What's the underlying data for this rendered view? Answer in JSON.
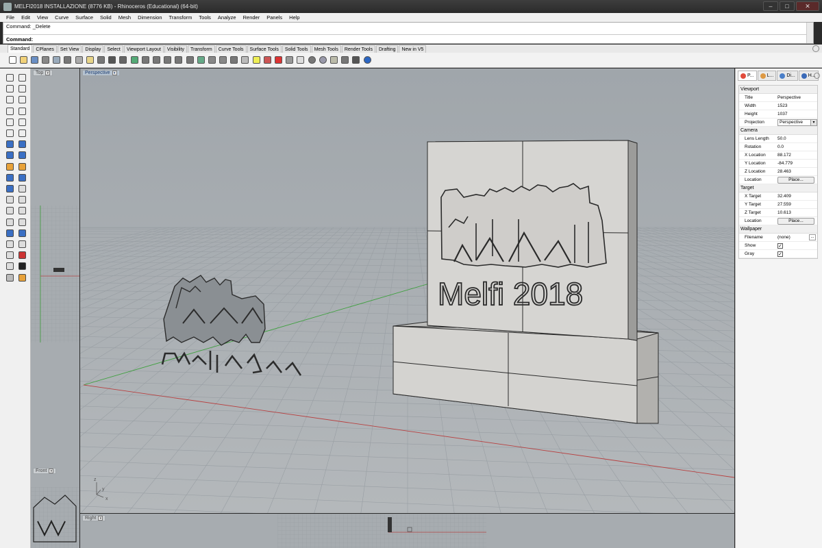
{
  "window": {
    "title": "MELFI2018 INSTALLAZIONE (8776 KB) - Rhinoceros (Educational) (64-bit)",
    "minimize": "–",
    "maximize": "□",
    "close": "✕"
  },
  "menu": [
    "File",
    "Edit",
    "View",
    "Curve",
    "Surface",
    "Solid",
    "Mesh",
    "Dimension",
    "Transform",
    "Tools",
    "Analyze",
    "Render",
    "Panels",
    "Help"
  ],
  "command": {
    "history": "Command: _Delete",
    "prompt": "Command:",
    "value": ""
  },
  "tabs": [
    "Standard",
    "CPlanes",
    "Set View",
    "Display",
    "Select",
    "Viewport Layout",
    "Visibility",
    "Transform",
    "Curve Tools",
    "Surface Tools",
    "Solid Tools",
    "Mesh Tools",
    "Render Tools",
    "Drafting",
    "New in V5"
  ],
  "active_tab": "Standard",
  "toolbar_icons": [
    "new-icon",
    "open-icon",
    "save-icon",
    "print-icon",
    "import-icon",
    "cut-icon",
    "copy-icon",
    "paste-icon",
    "undo-icon",
    "pan-icon",
    "move-icon",
    "rotate-view-icon",
    "zoom-icon",
    "zoom-window-icon",
    "zoom-extents-icon",
    "zoom-selected-icon",
    "rotate-icon",
    "four-view-icon",
    "grid-icon",
    "select-icon",
    "hide-icon",
    "lock-icon",
    "light-icon",
    "layer-icon",
    "properties-icon",
    "render-icon",
    "material-icon",
    "sphere-icon",
    "environment-icon",
    "options-icon",
    "walk-icon",
    "snap-icon",
    "help-icon"
  ],
  "viewports": {
    "top": "Top",
    "perspective": "Perspective",
    "front": "Front",
    "right": "Right"
  },
  "model": {
    "label": "Melfi 2018"
  },
  "panel": {
    "tabs": [
      "P...",
      "L...",
      "Di...",
      "H..."
    ],
    "sections": {
      "viewport": "Viewport",
      "camera": "Camera",
      "target": "Target",
      "wallpaper": "Wallpaper"
    },
    "viewport": {
      "title_label": "Title",
      "title": "Perspective",
      "width_label": "Width",
      "width": "1523",
      "height_label": "Height",
      "height": "1037",
      "projection_label": "Projection",
      "projection": "Perspective"
    },
    "camera": {
      "lens_label": "Lens Length",
      "lens": "50.0",
      "rotation_label": "Rotation",
      "rotation": "0.0",
      "x_label": "X Location",
      "x": "88.172",
      "y_label": "Y Location",
      "y": "-84.779",
      "z_label": "Z Location",
      "z": "28.463",
      "location_label": "Location",
      "place": "Place..."
    },
    "target": {
      "x_label": "X Target",
      "x": "32.409",
      "y_label": "Y Target",
      "y": "27.559",
      "z_label": "Z Target",
      "z": "10.613",
      "location_label": "Location",
      "place": "Place..."
    },
    "wallpaper": {
      "filename_label": "Filename",
      "filename": "(none)",
      "browse": "...",
      "show_label": "Show",
      "show": true,
      "gray_label": "Gray",
      "gray": true
    }
  }
}
